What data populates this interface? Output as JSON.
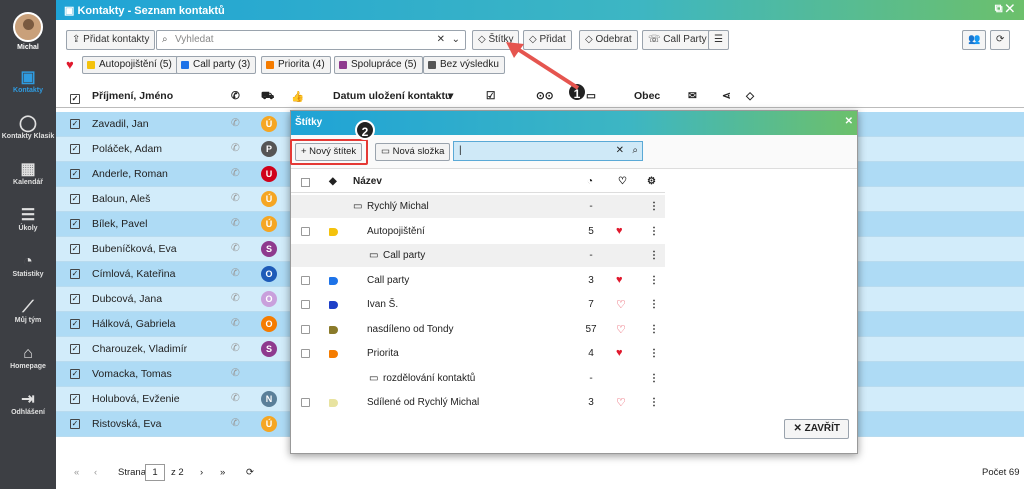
{
  "window": {
    "title": "Kontakty - Seznam kontaktů"
  },
  "sidebar": {
    "user": "Michal",
    "items": [
      {
        "label": "Kontakty",
        "icon": "contact-card-icon",
        "glyph": "▣"
      },
      {
        "label": "Kontakty Klasik",
        "icon": "user-icon",
        "glyph": "◯"
      },
      {
        "label": "Kalendář",
        "icon": "calendar-icon",
        "glyph": "▦"
      },
      {
        "label": "Úkoly",
        "icon": "tasks-icon",
        "glyph": "☰"
      },
      {
        "label": "Statistiky",
        "icon": "pie-chart-icon",
        "glyph": "◔"
      },
      {
        "label": "Můj tým",
        "icon": "trend-icon",
        "glyph": "⟋"
      },
      {
        "label": "Homepage",
        "icon": "home-icon",
        "glyph": "⌂"
      },
      {
        "label": "Odhlášení",
        "icon": "logout-icon",
        "glyph": "⇥"
      }
    ]
  },
  "toolbar": {
    "add_contacts": "Přidat kontakty",
    "search_placeholder": "Vyhledat",
    "labels": "Štítky",
    "add": "Přidat",
    "remove": "Odebrat",
    "call_party": "Call Party"
  },
  "tags": [
    {
      "label": "Autopojištění (5)",
      "color": "#f4c20d"
    },
    {
      "label": "Call party (3)",
      "color": "#1e73e8"
    },
    {
      "label": "Priorita (4)",
      "color": "#f57c00"
    },
    {
      "label": "Spolupráce (5)",
      "color": "#8e3a8e"
    },
    {
      "label": "Bez výsledku",
      "color": "#555555"
    }
  ],
  "table": {
    "headers": {
      "name": "Příjmení, Jméno",
      "date": "Datum uložení kontaktu",
      "city": "Obec"
    },
    "rows": [
      {
        "name": "Zavadil, Jan",
        "badge": "Ú",
        "color": "#f5a623"
      },
      {
        "name": "Poláček, Adam",
        "badge": "P",
        "color": "#555555"
      },
      {
        "name": "Anderle, Roman",
        "badge": "U",
        "color": "#d0021b"
      },
      {
        "name": "Baloun, Aleš",
        "badge": "Ú",
        "color": "#f5a623"
      },
      {
        "name": "Bílek, Pavel",
        "badge": "Ú",
        "color": "#f5a623"
      },
      {
        "name": "Bubeníčková, Eva",
        "badge": "S",
        "color": "#8e3a8e"
      },
      {
        "name": "Címlová, Kateřina",
        "badge": "O",
        "color": "#1e5bb8"
      },
      {
        "name": "Dubcová, Jana",
        "badge": "O",
        "color": "#c9a0dc"
      },
      {
        "name": "Hálková, Gabriela",
        "badge": "O",
        "color": "#f57c00"
      },
      {
        "name": "Charouzek, Vladimír",
        "badge": "S",
        "color": "#8e3a8e"
      },
      {
        "name": "Vomacka, Tomas",
        "badge": "",
        "color": ""
      },
      {
        "name": "Holubová, Evženie",
        "badge": "N",
        "color": "#5a7f99"
      },
      {
        "name": "Ristovská, Eva",
        "badge": "Ú",
        "color": "#f5a623"
      }
    ]
  },
  "pager": {
    "page_label": "Strana",
    "page": "1",
    "of": "z 2",
    "count": "Počet 69"
  },
  "modal": {
    "title": "Štítky",
    "new_label": "+ Nový štítek",
    "new_folder": "Nová složka",
    "col_name": "Název",
    "close": "ZAVŘÍT",
    "rows": [
      {
        "name": "Rychlý Michal",
        "count": "-",
        "fav": "",
        "indent": 1,
        "folder": true,
        "gray": true,
        "checkbox": false,
        "tag": ""
      },
      {
        "name": "Autopojištění",
        "count": "5",
        "fav": "♥",
        "indent": 1,
        "folder": false,
        "gray": false,
        "checkbox": true,
        "tag": "#f4c20d"
      },
      {
        "name": "Call party",
        "count": "-",
        "fav": "",
        "indent": 2,
        "folder": true,
        "gray": true,
        "checkbox": false,
        "tag": ""
      },
      {
        "name": "Call party",
        "count": "3",
        "fav": "♥",
        "indent": 1,
        "folder": false,
        "gray": false,
        "checkbox": true,
        "tag": "#1e73e8"
      },
      {
        "name": "Ivan Š.",
        "count": "7",
        "fav": "♡",
        "indent": 1,
        "folder": false,
        "gray": false,
        "checkbox": true,
        "tag": "#1e3fc8"
      },
      {
        "name": "nasdíleno od Tondy",
        "count": "57",
        "fav": "♡",
        "indent": 1,
        "folder": false,
        "gray": false,
        "checkbox": true,
        "tag": "#8a7a2a"
      },
      {
        "name": "Priorita",
        "count": "4",
        "fav": "♥",
        "indent": 1,
        "folder": false,
        "gray": false,
        "checkbox": true,
        "tag": "#f57c00"
      },
      {
        "name": "rozdělování kontaktů",
        "count": "-",
        "fav": "",
        "indent": 2,
        "folder": true,
        "gray": false,
        "checkbox": false,
        "tag": ""
      },
      {
        "name": "Sdílené od Rychlý Michal",
        "count": "3",
        "fav": "♡",
        "indent": 1,
        "folder": false,
        "gray": false,
        "checkbox": true,
        "tag": "#e8e3a0"
      }
    ]
  },
  "callouts": {
    "one": "1",
    "two": "2"
  }
}
